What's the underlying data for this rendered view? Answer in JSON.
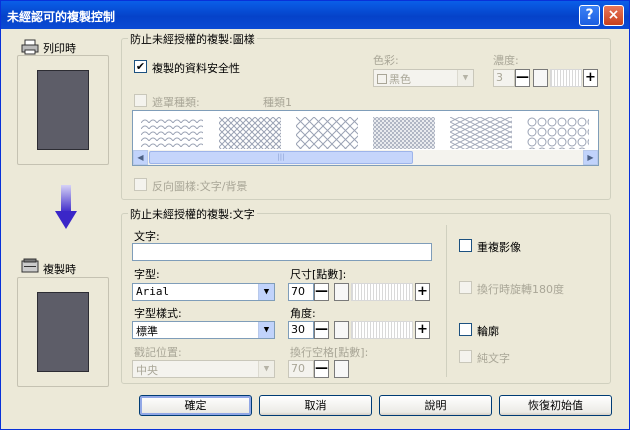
{
  "window": {
    "title": "未經認可的複製控制",
    "help": "?",
    "close": "×"
  },
  "side": {
    "print_label": "列印時",
    "copy_label": "複製時"
  },
  "pattern_group": {
    "legend": "防止未經授權的複製:圖樣",
    "security_label": "複製的資料安全性",
    "security_checked": "✔",
    "color_label": "色彩:",
    "color_value": "黑色",
    "density_label": "濃度:",
    "density_value": "3",
    "mask_label": "遮罩種類:",
    "mask_value": "種類1",
    "invert_label": "反向圖樣:文字/背景",
    "patterns": [
      "scales",
      "diamond",
      "crosshatch",
      "grid",
      "weave",
      "circles"
    ]
  },
  "text_group": {
    "legend": "防止未經授權的複製:文字",
    "text_label": "文字:",
    "text_value": "",
    "font_label": "字型:",
    "font_value": "Arial",
    "size_label": "尺寸[點數]:",
    "size_value": "70",
    "style_label": "字型樣式:",
    "style_value": "標準",
    "angle_label": "角度:",
    "angle_value": "30",
    "position_label": "戳記位置:",
    "position_value": "中央",
    "spacing_label": "換行空格[點數]:",
    "spacing_value": "70",
    "repeat_label": "重複影像",
    "rotate_label": "換行時旋轉180度",
    "outline_label": "輪廓",
    "plain_label": "純文字"
  },
  "buttons": {
    "ok": "確定",
    "cancel": "取消",
    "help": "說明",
    "reset": "恢復初始值"
  },
  "stepper": {
    "minus": "—",
    "plus": "+"
  },
  "colors": {
    "title_bar": "#0542c9",
    "arrow": "#5a4bd6",
    "preview": "#5d5d68"
  }
}
